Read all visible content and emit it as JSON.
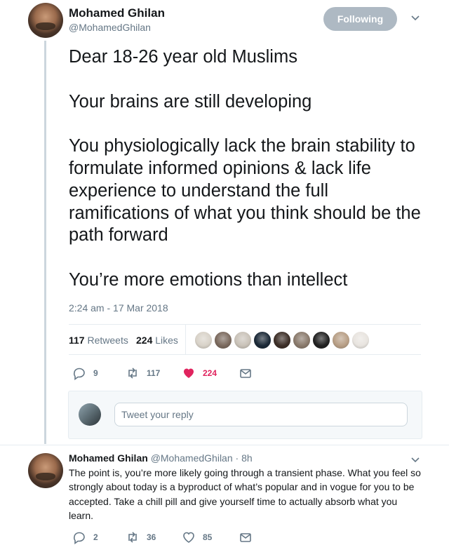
{
  "tweet": {
    "author_name": "Mohamed Ghilan",
    "author_handle": "@MohamedGhilan",
    "follow_label": "Following",
    "text": "Dear 18-26 year old Muslims\n\nYour brains are still developing\n\nYou physiologically lack the brain stability to formulate informed opinions & lack life experience to understand the full ramifications of what you think should be the path forward\n\nYou’re more emotions than intellect",
    "timestamp": "2:24 am - 17 Mar 2018",
    "retweets_count": "117",
    "retweets_label": "Retweets",
    "likes_count": "224",
    "likes_label": "Likes",
    "actions": {
      "replies": "9",
      "retweets": "117",
      "likes": "224"
    }
  },
  "liker_colors": [
    "#d8d2c8",
    "#7b6a5e",
    "#c9c2b8",
    "#1c2a38",
    "#3d2f28",
    "#8a7a6c",
    "#222222",
    "#b89f86",
    "#e8e4df"
  ],
  "reply_box": {
    "placeholder": "Tweet your reply"
  },
  "reply": {
    "author_name": "Mohamed Ghilan",
    "author_handle": "@MohamedGhilan",
    "time": "· 8h",
    "text": "The point is, you’re more likely going through a transient phase. What you feel so strongly about today is a byproduct of what’s popular and in vogue for you to be accepted. Take a chill pill and give yourself time to actually absorb what you learn.",
    "actions": {
      "replies": "2",
      "retweets": "36",
      "likes": "85"
    }
  },
  "colors": {
    "like_red": "#e0245e",
    "gray": "#657786",
    "follow_bg": "#aeb9c3"
  }
}
